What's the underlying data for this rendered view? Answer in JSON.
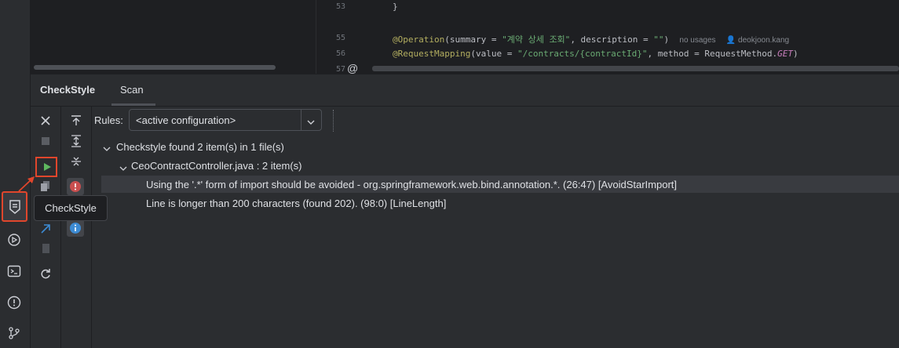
{
  "editor": {
    "lines": [
      {
        "num": "53",
        "text": "}"
      },
      {
        "num": "55",
        "annotation": "@Operation",
        "code_a": "(summary = ",
        "str_a": "\"계약 상세 조회\"",
        "code_b": ", description = ",
        "str_b": "\"\"",
        "code_c": ")",
        "hint_usages": "no usages",
        "hint_author": "deokjoon.kang"
      },
      {
        "num": "56",
        "annotation": "@RequestMapping",
        "code_a": "(value = ",
        "str_a": "\"/contracts/{contractId}\"",
        "code_b": ", method = RequestMethod.",
        "const": "GET",
        "code_c": ")"
      },
      {
        "num": "57",
        "gutter_icon": "@"
      }
    ]
  },
  "panel": {
    "tabs": [
      {
        "label": "CheckStyle",
        "active": true
      },
      {
        "label": "Scan",
        "active": false
      }
    ],
    "rules_label": "Rules:",
    "rules_value": "<active configuration>",
    "tree": {
      "root": "Checkstyle found 2 item(s) in 1 file(s)",
      "file": "CeoContractController.java : 2 item(s)",
      "items": [
        "Using the '.*' form of import should be avoided - org.springframework.web.bind.annotation.*. (26:47) [AvoidStarImport]",
        "Line is longer than 200 characters (found 202). (98:0) [LineLength]"
      ]
    }
  },
  "tooltip": "CheckStyle",
  "colors": {
    "highlight": "#e0462c",
    "run_green": "#5fb85f",
    "error_red": "#c94f4f",
    "info_blue": "#3d8bd3",
    "selected_row": "#393b40"
  },
  "icons": [
    "close-icon",
    "stop-icon",
    "run-icon",
    "copy-icon",
    "diff-icon",
    "file-icon",
    "refresh-icon",
    "scroll-to-top-icon",
    "expand-all-icon",
    "collapse-all-icon",
    "error-filter-icon",
    "info-filter-icon",
    "checkstyle-icon",
    "run-config-icon",
    "terminal-icon",
    "problems-icon",
    "git-icon"
  ]
}
